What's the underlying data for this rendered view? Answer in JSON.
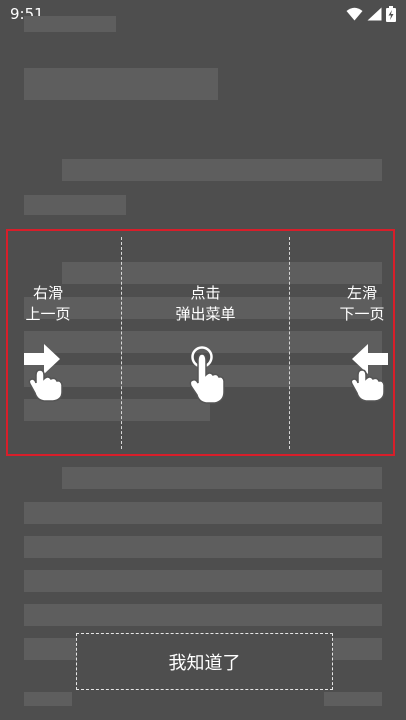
{
  "status_bar": {
    "time": "9:51",
    "icons": [
      "wifi-icon",
      "signal-icon",
      "battery-charging-icon"
    ]
  },
  "guide": {
    "left_zone": {
      "line1": "右滑",
      "line2": "上一页",
      "icon": "swipe-right-hand-icon"
    },
    "center_zone": {
      "line1": "点击",
      "line2": "弹出菜单",
      "icon": "tap-hand-icon"
    },
    "right_zone": {
      "line1": "左滑",
      "line2": "下一页",
      "icon": "swipe-left-hand-icon"
    },
    "highlight_color": "#d81e2a"
  },
  "dismiss_button": {
    "label": "我知道了"
  },
  "colors": {
    "overlay": "#4e4e4e",
    "skeleton": "#5e5e5e"
  }
}
